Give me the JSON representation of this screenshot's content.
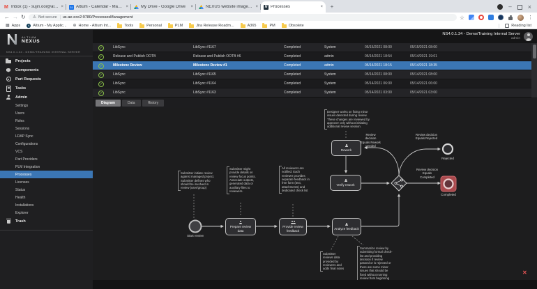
{
  "browser": {
    "tabs": [
      {
        "title": "Inbox (1) - sujin.ooi@altium.co"
      },
      {
        "title": "Altium - Calendar - May 2021"
      },
      {
        "title": "My Drive - Google Drive"
      },
      {
        "title": "NEXUS website images - Googl"
      },
      {
        "title": "Processes"
      }
    ],
    "security_chip": "Not secure",
    "url": "us-ae-eoc2:9780/ProcessesManagement",
    "bookmarks": {
      "apps": "Apps",
      "items": [
        "Altium - My Applic...",
        "Home - Altium Int...",
        "Tools",
        "Personal",
        "PLM",
        "Jira Release Roadm...",
        "A365",
        "PM",
        "Obsolete"
      ],
      "reading_list": "Reading list"
    }
  },
  "header": {
    "brand_line1": "ALTIUM",
    "brand_line2": "NEXUS",
    "server": "NS4.0.1.34 - Demo/Training Internal Server",
    "user": "admin"
  },
  "sidebar": {
    "server_caption": "NS4.0.1.34 - DEMO/TRAINING INTERNAL SERVER",
    "items": [
      "Projects",
      "Components",
      "Part Requests",
      "Tasks",
      "Admin"
    ],
    "admin_children": [
      "Settings",
      "Users",
      "Roles",
      "Sessions",
      "LDAP Sync",
      "Configurations",
      "VCS",
      "Part Providers",
      "PLM Integration",
      "Processes",
      "Licenses",
      "Status",
      "Health",
      "Installations",
      "Explorer"
    ],
    "selected_item": "Processes",
    "trash": "Trash"
  },
  "process_table": {
    "rows": [
      {
        "process": "LibSync",
        "instance": "LibSync #1167",
        "state": "Completed",
        "started_by": "System",
        "started": "05/15/2021 08:00",
        "finished": "05/15/2021 08:00"
      },
      {
        "process": "Release and Publish OOTB",
        "instance": "Release and Publish OOTB #6",
        "state": "Completed",
        "started_by": "admin",
        "started": "05/14/2021 18:54",
        "finished": "05/14/2021 19:01"
      },
      {
        "process": "Milestone Review",
        "instance": "Milestone Review #1",
        "state": "Completed",
        "started_by": "admin",
        "started": "05/14/2021 18:15",
        "finished": "05/14/2021 18:35",
        "selected": true
      },
      {
        "process": "LibSync",
        "instance": "LibSync #1165",
        "state": "Completed",
        "started_by": "System",
        "started": "05/14/2021 08:00",
        "finished": "05/14/2021 08:00"
      },
      {
        "process": "LibSync",
        "instance": "LibSync #1164",
        "state": "Completed",
        "started_by": "System",
        "started": "05/14/2021 06:00",
        "finished": "05/14/2021 06:00"
      },
      {
        "process": "LibSync",
        "instance": "LibSync #1163",
        "state": "Completed",
        "started_by": "System",
        "started": "05/14/2021 03:00",
        "finished": "05/14/2021 03:00"
      }
    ]
  },
  "view_tabs": [
    {
      "label": "Diagram",
      "active": true
    },
    {
      "label": "Data"
    },
    {
      "label": "History"
    }
  ],
  "diagram": {
    "nodes": {
      "start": "Start review",
      "prepare": "Prepare review data",
      "provide": "Provide review feedback",
      "analyze": "Analyze feedback",
      "rework": "Rework",
      "verify": "Verify rework",
      "rejected": "Rejected",
      "completed": "Completed"
    },
    "edge_labels": {
      "rework": "Review decision Equals Rework needed",
      "rejected": "Review decision Equals Rejected",
      "completed": "Review decision Equals Completed"
    },
    "annotations": [
      "Submitter initiate review against managed project. Submitter defines who should be involved in review (user/group)",
      "Submitter might provide details on review focus points. Associate outputs, generated data or auxiliary files to reviewers.",
      "All reviewers are notified. Each reviewer provides separate feedback in free form (text, attachments) and dedicated check list",
      "Designer works on fixing minor issues detected during review. These changes are reviewed by approver only without initiating additional review session.",
      "Submitter reviews data provided by reviewers and adds final notes",
      "Summarize review by submitting formal check-list and providing decision if review passed or is rejected or there are some minor issues that should be fixed without running review from beginning"
    ]
  },
  "colors": {
    "accent_blue": "#3b76b4",
    "status_green": "#8bc34a",
    "completed_highlight": "#a9494d"
  }
}
